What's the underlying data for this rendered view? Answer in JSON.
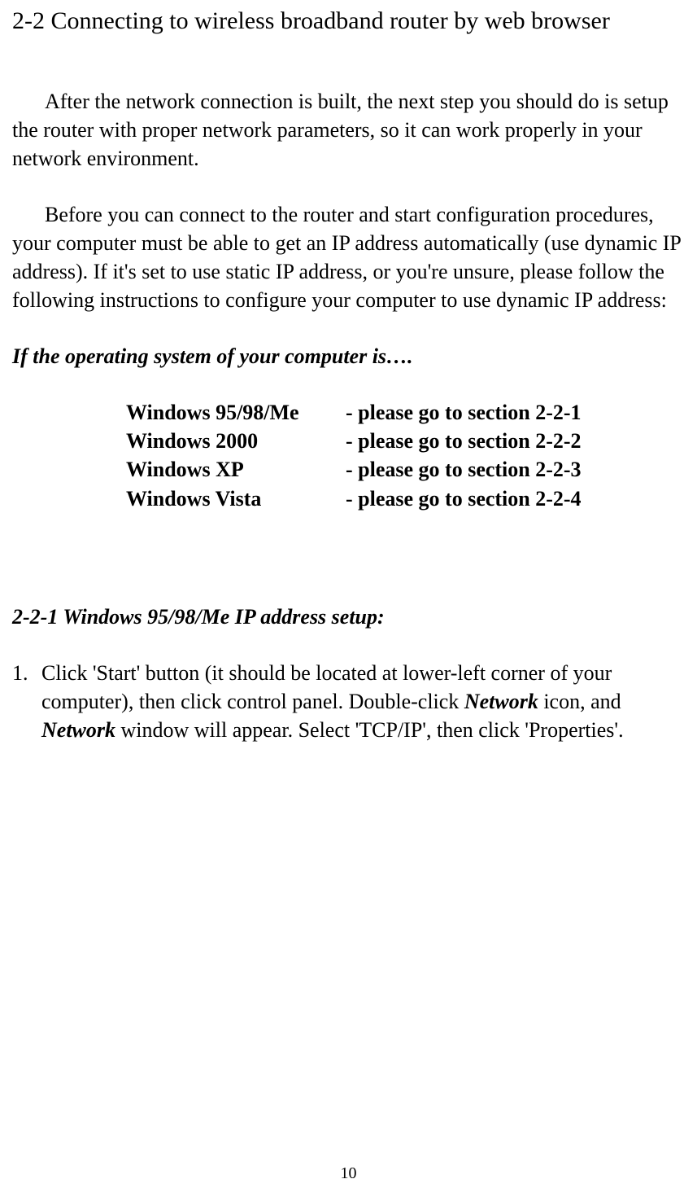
{
  "heading": "2-2 Connecting to wireless broadband router by web browser",
  "para1": "After the network connection is built, the next step you should do is setup the router with proper network parameters, so it can work properly in your network environment.",
  "para2": "Before you can connect to the router and start configuration procedures, your computer must be able to get an IP address automatically (use dynamic IP address). If it's set to use static IP address, or you're unsure, please follow the following instructions to configure your computer to use dynamic IP address:",
  "os_intro": "If the operating system of your computer is….",
  "os_list": [
    {
      "name": "Windows 95/98/Me",
      "section": "- please go to section 2-2-1"
    },
    {
      "name": "Windows 2000",
      "section": "- please go to section 2-2-2"
    },
    {
      "name": "Windows XP",
      "section": "- please go to section 2-2-3"
    },
    {
      "name": "Windows Vista",
      "section": "- please go to section 2-2-4"
    }
  ],
  "subheading": "2-2-1 Windows 95/98/Me IP address setup:",
  "step1": {
    "marker": "1.",
    "t1": "Click 'Start' button (it should be located at lower-left corner of your computer), then click control panel. Double-click ",
    "em1": "Network",
    "t2": " icon, and ",
    "em2": "Network",
    "t3": " window will appear. Select 'TCP/IP', then click 'Properties'."
  },
  "page_number": "10"
}
